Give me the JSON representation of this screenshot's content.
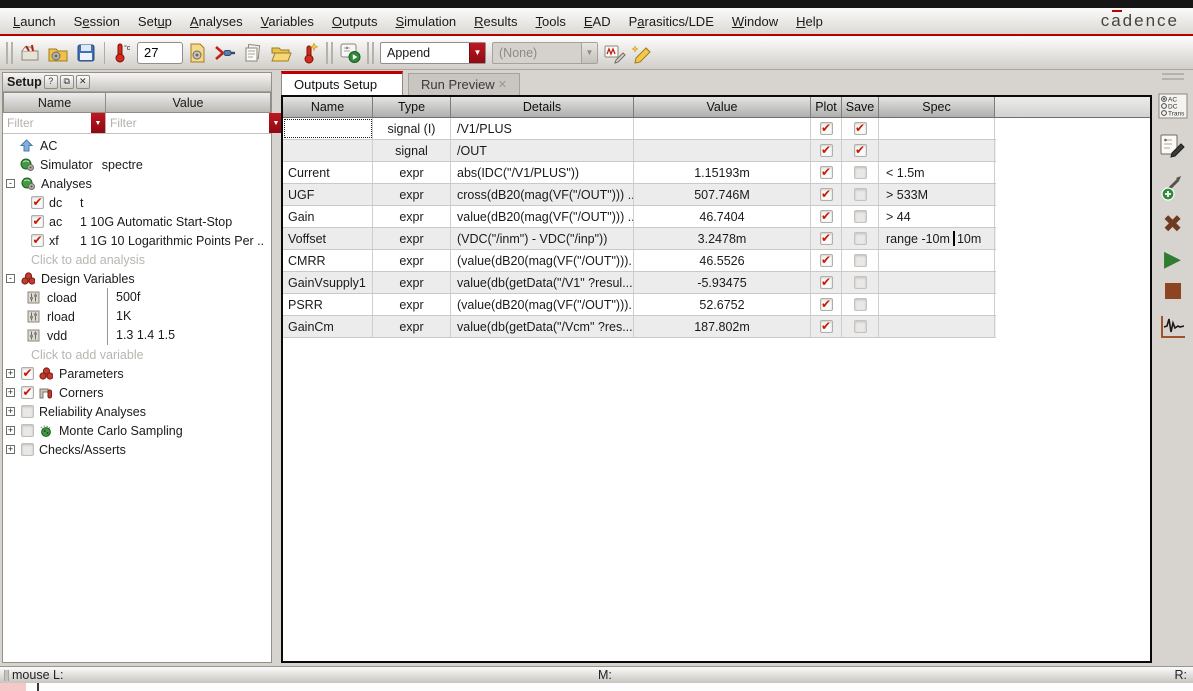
{
  "logo": "cadence",
  "menu": {
    "items": [
      {
        "label": "Launch",
        "u": 0
      },
      {
        "label": "Session",
        "u": 1
      },
      {
        "label": "Setup",
        "u": 3
      },
      {
        "label": "Analyses",
        "u": 0
      },
      {
        "label": "Variables",
        "u": 0
      },
      {
        "label": "Outputs",
        "u": 0
      },
      {
        "label": "Simulation",
        "u": 0
      },
      {
        "label": "Results",
        "u": 0
      },
      {
        "label": "Tools",
        "u": 0
      },
      {
        "label": "EAD",
        "u": 0
      },
      {
        "label": "Parasitics/LDE",
        "u": 1
      },
      {
        "label": "Window",
        "u": 0
      },
      {
        "label": "Help",
        "u": 0
      }
    ]
  },
  "toolbar": {
    "temp_label": "°c",
    "temp_value": "27",
    "mode_combo_value": "Append",
    "preset_combo_value": "(None)"
  },
  "setup_panel": {
    "title": "Setup",
    "buttons": [
      "?",
      "⧉",
      "✕"
    ],
    "columns": [
      "Name",
      "Value"
    ],
    "filter_placeholder": "Filter",
    "tree": [
      {
        "kind": "top",
        "icon": "ac",
        "label": "AC"
      },
      {
        "kind": "top",
        "icon": "globe",
        "label": "Simulator",
        "value": "spectre",
        "vmode": "inline"
      },
      {
        "kind": "root",
        "expander": "-",
        "icon": "globe",
        "label": "Analyses"
      },
      {
        "kind": "analysis",
        "check": true,
        "label": "dc",
        "value": "t",
        "vmode": "a"
      },
      {
        "kind": "analysis",
        "check": true,
        "label": "ac",
        "value": "1 10G Automatic Start-Stop",
        "vmode": "a"
      },
      {
        "kind": "analysis",
        "check": true,
        "label": "xf",
        "value": "1 1G 10 Logarithmic Points Per ..",
        "vmode": "a"
      },
      {
        "kind": "ph",
        "label": "Click to add analysis"
      },
      {
        "kind": "root",
        "expander": "-",
        "icon": "vars",
        "label": "Design Variables"
      },
      {
        "kind": "variable",
        "icon": "slider",
        "label": "cload",
        "value": "500f",
        "vmode": "v"
      },
      {
        "kind": "variable",
        "icon": "slider",
        "label": "rload",
        "value": "1K",
        "vmode": "v"
      },
      {
        "kind": "variable",
        "icon": "slider",
        "label": "vdd",
        "value": "1.3 1.4 1.5",
        "vmode": "v"
      },
      {
        "kind": "ph",
        "label": "Click to add variable"
      },
      {
        "kind": "root",
        "expander": "+",
        "check": true,
        "icon": "vars",
        "label": "Parameters"
      },
      {
        "kind": "root",
        "expander": "+",
        "check": true,
        "icon": "corner",
        "label": "Corners"
      },
      {
        "kind": "root",
        "expander": "+",
        "check": false,
        "label": "Reliability Analyses"
      },
      {
        "kind": "root",
        "expander": "+",
        "check": false,
        "icon": "mc",
        "label": "Monte Carlo Sampling"
      },
      {
        "kind": "root",
        "expander": "+",
        "check": false,
        "label": "Checks/Asserts"
      }
    ]
  },
  "tabs": [
    {
      "label": "Outputs Setup",
      "active": true
    },
    {
      "label": "Run Preview",
      "active": false,
      "closable": true
    }
  ],
  "outputs_table": {
    "columns": [
      "Name",
      "Type",
      "Details",
      "Value",
      "Plot",
      "Save",
      "Spec"
    ],
    "rows": [
      {
        "name": "",
        "type": "signal (I)",
        "details": "/V1/PLUS",
        "value": "",
        "plot": true,
        "save": true,
        "spec": "",
        "focus": true
      },
      {
        "name": "",
        "type": "signal",
        "details": "/OUT",
        "value": "",
        "plot": true,
        "save": true,
        "spec": ""
      },
      {
        "name": "Current",
        "type": "expr",
        "details": "abs(IDC(\"/V1/PLUS\"))",
        "value": "1.15193m",
        "plot": true,
        "save": false,
        "spec": "<  1.5m"
      },
      {
        "name": "UGF",
        "type": "expr",
        "details": "cross(dB20(mag(VF(\"/OUT\"))) ...",
        "value": "507.746M",
        "plot": true,
        "save": false,
        "spec": ">  533M"
      },
      {
        "name": "Gain",
        "type": "expr",
        "details": "value(dB20(mag(VF(\"/OUT\"))) ...",
        "value": "46.7404",
        "plot": true,
        "save": false,
        "spec": ">  44"
      },
      {
        "name": "Voffset",
        "type": "expr",
        "details": "(VDC(\"/inm\") - VDC(\"/inp\"))",
        "value": "3.2478m",
        "plot": true,
        "save": false,
        "spec": "range  -10m",
        "spec_after": "10m",
        "editing": true
      },
      {
        "name": "CMRR",
        "type": "expr",
        "details": "(value(dB20(mag(VF(\"/OUT\")))...",
        "value": "46.5526",
        "plot": true,
        "save": false,
        "spec": ""
      },
      {
        "name": "GainVsupply1",
        "type": "expr",
        "details": "value(db(getData(\"/V1\" ?resul...",
        "value": "-5.93475",
        "plot": true,
        "save": false,
        "spec": ""
      },
      {
        "name": "PSRR",
        "type": "expr",
        "details": "(value(dB20(mag(VF(\"/OUT\")))...",
        "value": "52.6752",
        "plot": true,
        "save": false,
        "spec": ""
      },
      {
        "name": "GainCm",
        "type": "expr",
        "details": "value(db(getData(\"/Vcm\" ?res...",
        "value": "187.802m",
        "plot": true,
        "save": false,
        "spec": ""
      }
    ]
  },
  "right_toolbar": {
    "chooser_options": [
      "AC",
      "DC",
      "Trans"
    ]
  },
  "status_bar": {
    "left": "mouse L:",
    "middle": "M:",
    "right": "R:"
  }
}
